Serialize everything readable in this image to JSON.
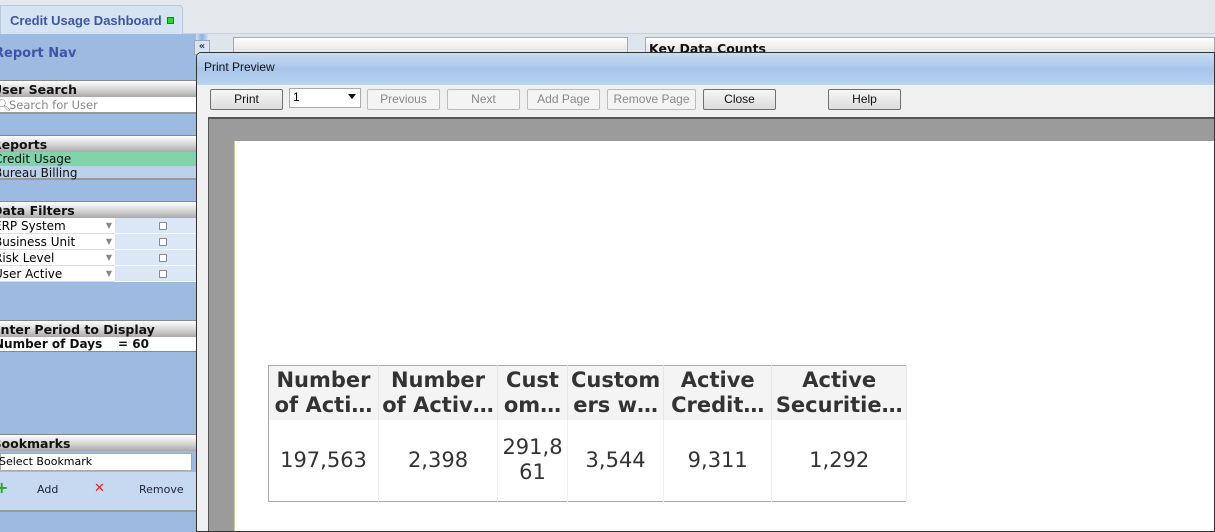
{
  "app_tab": {
    "title": "Credit Usage Dashboard",
    "status_color": "#1ee01e"
  },
  "nav": {
    "title": "Report Nav",
    "user_search": {
      "header": "User Search",
      "placeholder": "Search for User"
    },
    "reports": {
      "header": "Reports",
      "items": [
        {
          "label": "Credit Usage",
          "selected": true
        },
        {
          "label": "Bureau Billing",
          "selected": false
        }
      ]
    },
    "data_filters": {
      "header": "Data Filters",
      "items": [
        {
          "label": "ERP System"
        },
        {
          "label": "Business Unit"
        },
        {
          "label": "Risk Level"
        },
        {
          "label": "User Active"
        }
      ]
    },
    "period": {
      "header": "Enter Period to Display",
      "label": "Number of Days",
      "value": "= 60"
    },
    "bookmarks": {
      "header": "Bookmarks",
      "select_placeholder": "Select Bookmark",
      "add_label": "Add",
      "remove_label": "Remove"
    }
  },
  "background": {
    "key_data_title": "Key Data Counts"
  },
  "dialog": {
    "title": "Print Preview",
    "toolbar": {
      "print": "Print",
      "page": "1",
      "previous": "Previous",
      "next": "Next",
      "add_page": "Add Page",
      "remove_page": "Remove Page",
      "close": "Close",
      "help": "Help"
    },
    "table": {
      "headers": [
        "Number\nof Acti…",
        "Number\nof Activ…",
        "Cust\nom…",
        "Custom\ners w…",
        "Active\nCredit…",
        "Active\nSecuritie…"
      ],
      "values": [
        "197,563",
        "2,398",
        "291,8\n61",
        "3,544",
        "9,311",
        "1,292"
      ]
    }
  }
}
